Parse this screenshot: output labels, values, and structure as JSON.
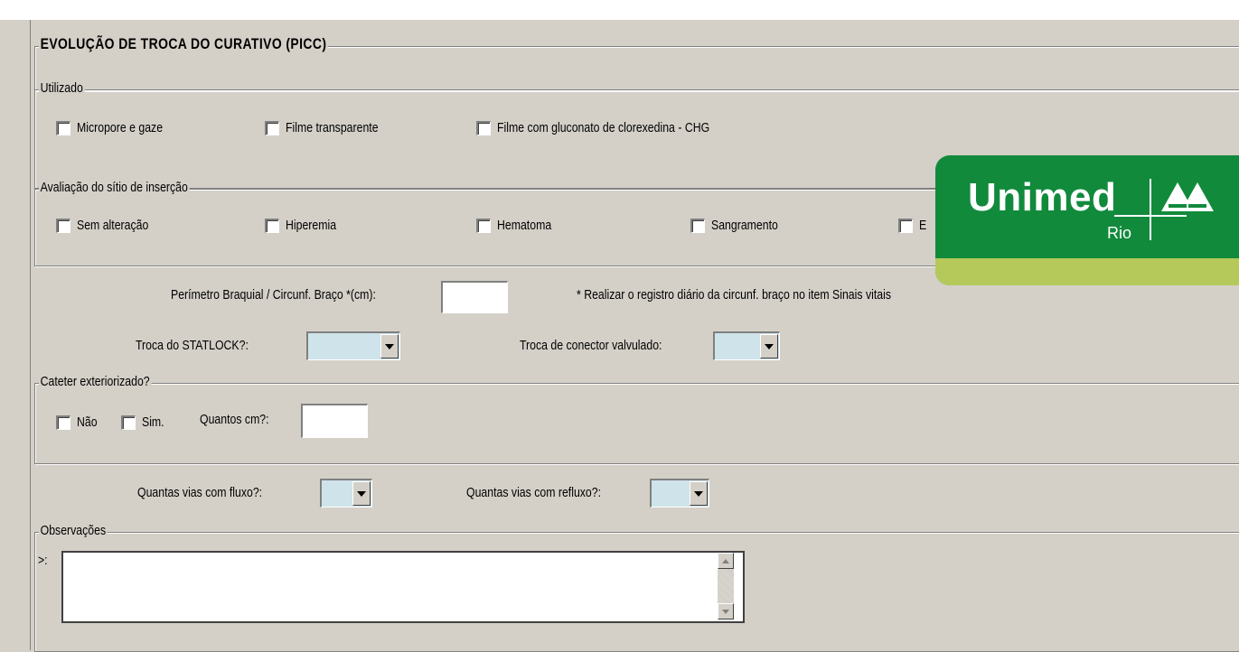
{
  "main": {
    "title": "EVOLUÇÃO DE TROCA DO CURATIVO (PICC)"
  },
  "utilizado": {
    "label": "Utilizado",
    "options": [
      "Micropore e gaze",
      "Filme transparente",
      "Filme com gluconato de clorexedina - CHG"
    ]
  },
  "avaliacao": {
    "label": "Avaliação do sítio de inserção",
    "options": [
      "Sem alteração",
      "Hiperemia",
      "Hematoma",
      "Sangramento",
      "E"
    ]
  },
  "perimetro": {
    "label": "Perímetro Braquial / Circunf. Braço *(cm):",
    "value": "",
    "note": "* Realizar o registro diário da circunf. braço no item Sinais vitais"
  },
  "statlock": {
    "label": "Troca do STATLOCK?:",
    "value": ""
  },
  "conector": {
    "label": "Troca de conector valvulado:",
    "value": ""
  },
  "cateter": {
    "label": "Cateter exteriorizado?",
    "nao": "Não",
    "sim": "Sim.",
    "quantos_label": "Quantos cm?:",
    "quantos_value": ""
  },
  "vias": {
    "fluxo_label": "Quantas vias com fluxo?:",
    "fluxo_value": "",
    "refluxo_label": "Quantas vias com refluxo?:",
    "refluxo_value": ""
  },
  "obs": {
    "label": "Observações",
    "prefix": ">:",
    "value": ""
  },
  "logo": {
    "brand": "Unimed",
    "sub": "Rio",
    "icon": "unimed-trees-icon"
  },
  "colors": {
    "background": "#d4d0c8",
    "combo": "#cfe3ea",
    "logo_green": "#118a3c",
    "logo_band": "#b5c95a"
  }
}
